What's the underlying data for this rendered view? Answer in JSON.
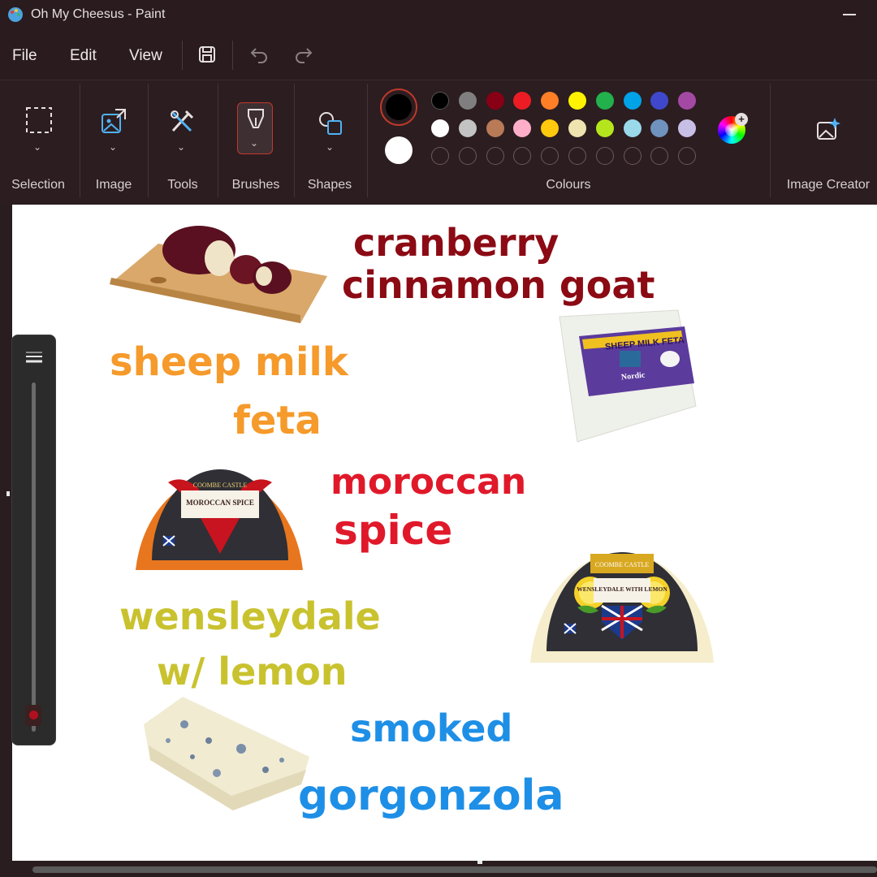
{
  "window": {
    "title": "Oh My Cheesus - Paint",
    "app_icon": "paint-palette-icon",
    "minimize_icon": "minimize-icon"
  },
  "menu": {
    "file": "File",
    "edit": "Edit",
    "view": "View",
    "save_icon": "save-icon",
    "undo_icon": "undo-icon",
    "redo_icon": "redo-icon"
  },
  "ribbon": {
    "selection": "Selection",
    "image": "Image",
    "tools": "Tools",
    "brushes": "Brushes",
    "shapes": "Shapes",
    "colours": "Colours",
    "image_creator": "Image Creator"
  },
  "colours": {
    "primary": "#000000",
    "secondary": "#ffffff",
    "row1": [
      "#000000",
      "#7f7f7f",
      "#880015",
      "#ed1c24",
      "#ff7f27",
      "#fff200",
      "#22b14c",
      "#00a2e8",
      "#3f48cc",
      "#a349a4"
    ],
    "row2": [
      "#ffffff",
      "#c3c3c3",
      "#b97a57",
      "#ffaec9",
      "#ffc90e",
      "#efe4b0",
      "#b5e61d",
      "#99d9ea",
      "#7092be",
      "#c8bfe7"
    ],
    "edit_colours_icon": "colour-wheel-icon"
  },
  "canvas_text": {
    "cranberry_l1": "cranberry",
    "cranberry_l2": "cinnamon goat",
    "feta_l1": "sheep milk",
    "feta_l2": "feta",
    "moroccan_l1": "moroccan",
    "moroccan_l2": "spice",
    "wensley_l1": "wensleydale",
    "wensley_l2": "w/ lemon",
    "gorgonzola_l1": "smoked",
    "gorgonzola_l2": "gorgonzola"
  },
  "labels": {
    "feta_pack": "SHEEP MILK FETA",
    "feta_brand": "Nordic",
    "moroccan_brand": "COOMBE CASTLE",
    "moroccan_name": "MOROCCAN SPICE",
    "lemon_brand": "COOMBE CASTLE",
    "lemon_name": "WENSLEYDALE WITH LEMON"
  },
  "text_colors": {
    "cranberry": "#8b0a14",
    "feta": "#f59a2b",
    "moroccan": "#e0192a",
    "wensley": "#c9c22f",
    "gorgonzola": "#1e8fe6"
  }
}
